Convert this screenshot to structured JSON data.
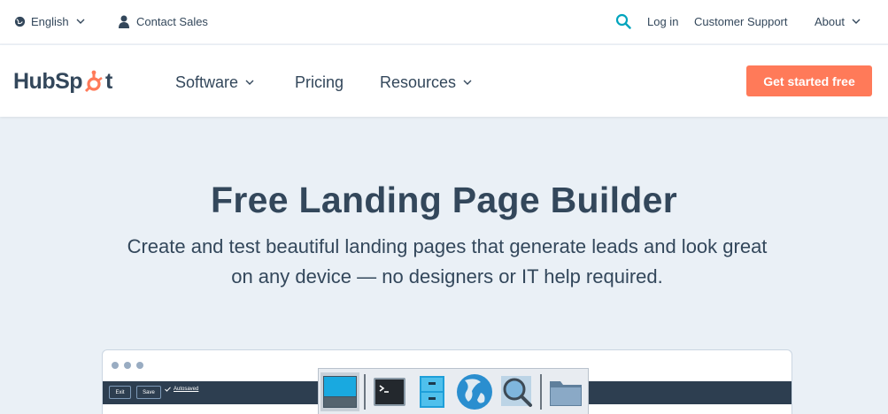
{
  "utility_bar": {
    "language": "English",
    "contact": "Contact Sales",
    "login": "Log in",
    "support": "Customer Support",
    "about": "About"
  },
  "nav": {
    "logo_text": [
      "HubSp",
      "t"
    ],
    "software": "Software",
    "pricing": "Pricing",
    "resources": "Resources",
    "cta": "Get started free"
  },
  "hero": {
    "title": "Free Landing Page Builder",
    "subtitle": "Create and test beautiful landing pages that generate leads and look great on any device — no designers or IT help required."
  },
  "mockup": {
    "exit": "Exit",
    "save": "Save",
    "autosaved": "Autosaved"
  },
  "dock": {
    "items": [
      "window-icon",
      "terminal-icon",
      "file-cabinet-icon",
      "globe-icon",
      "magnifier-icon",
      "folder-icon"
    ]
  },
  "colors": {
    "accent": "#ff7a59",
    "search": "#00a4bd",
    "text": "#33475b",
    "hero_bg": "#eaf0f6"
  }
}
